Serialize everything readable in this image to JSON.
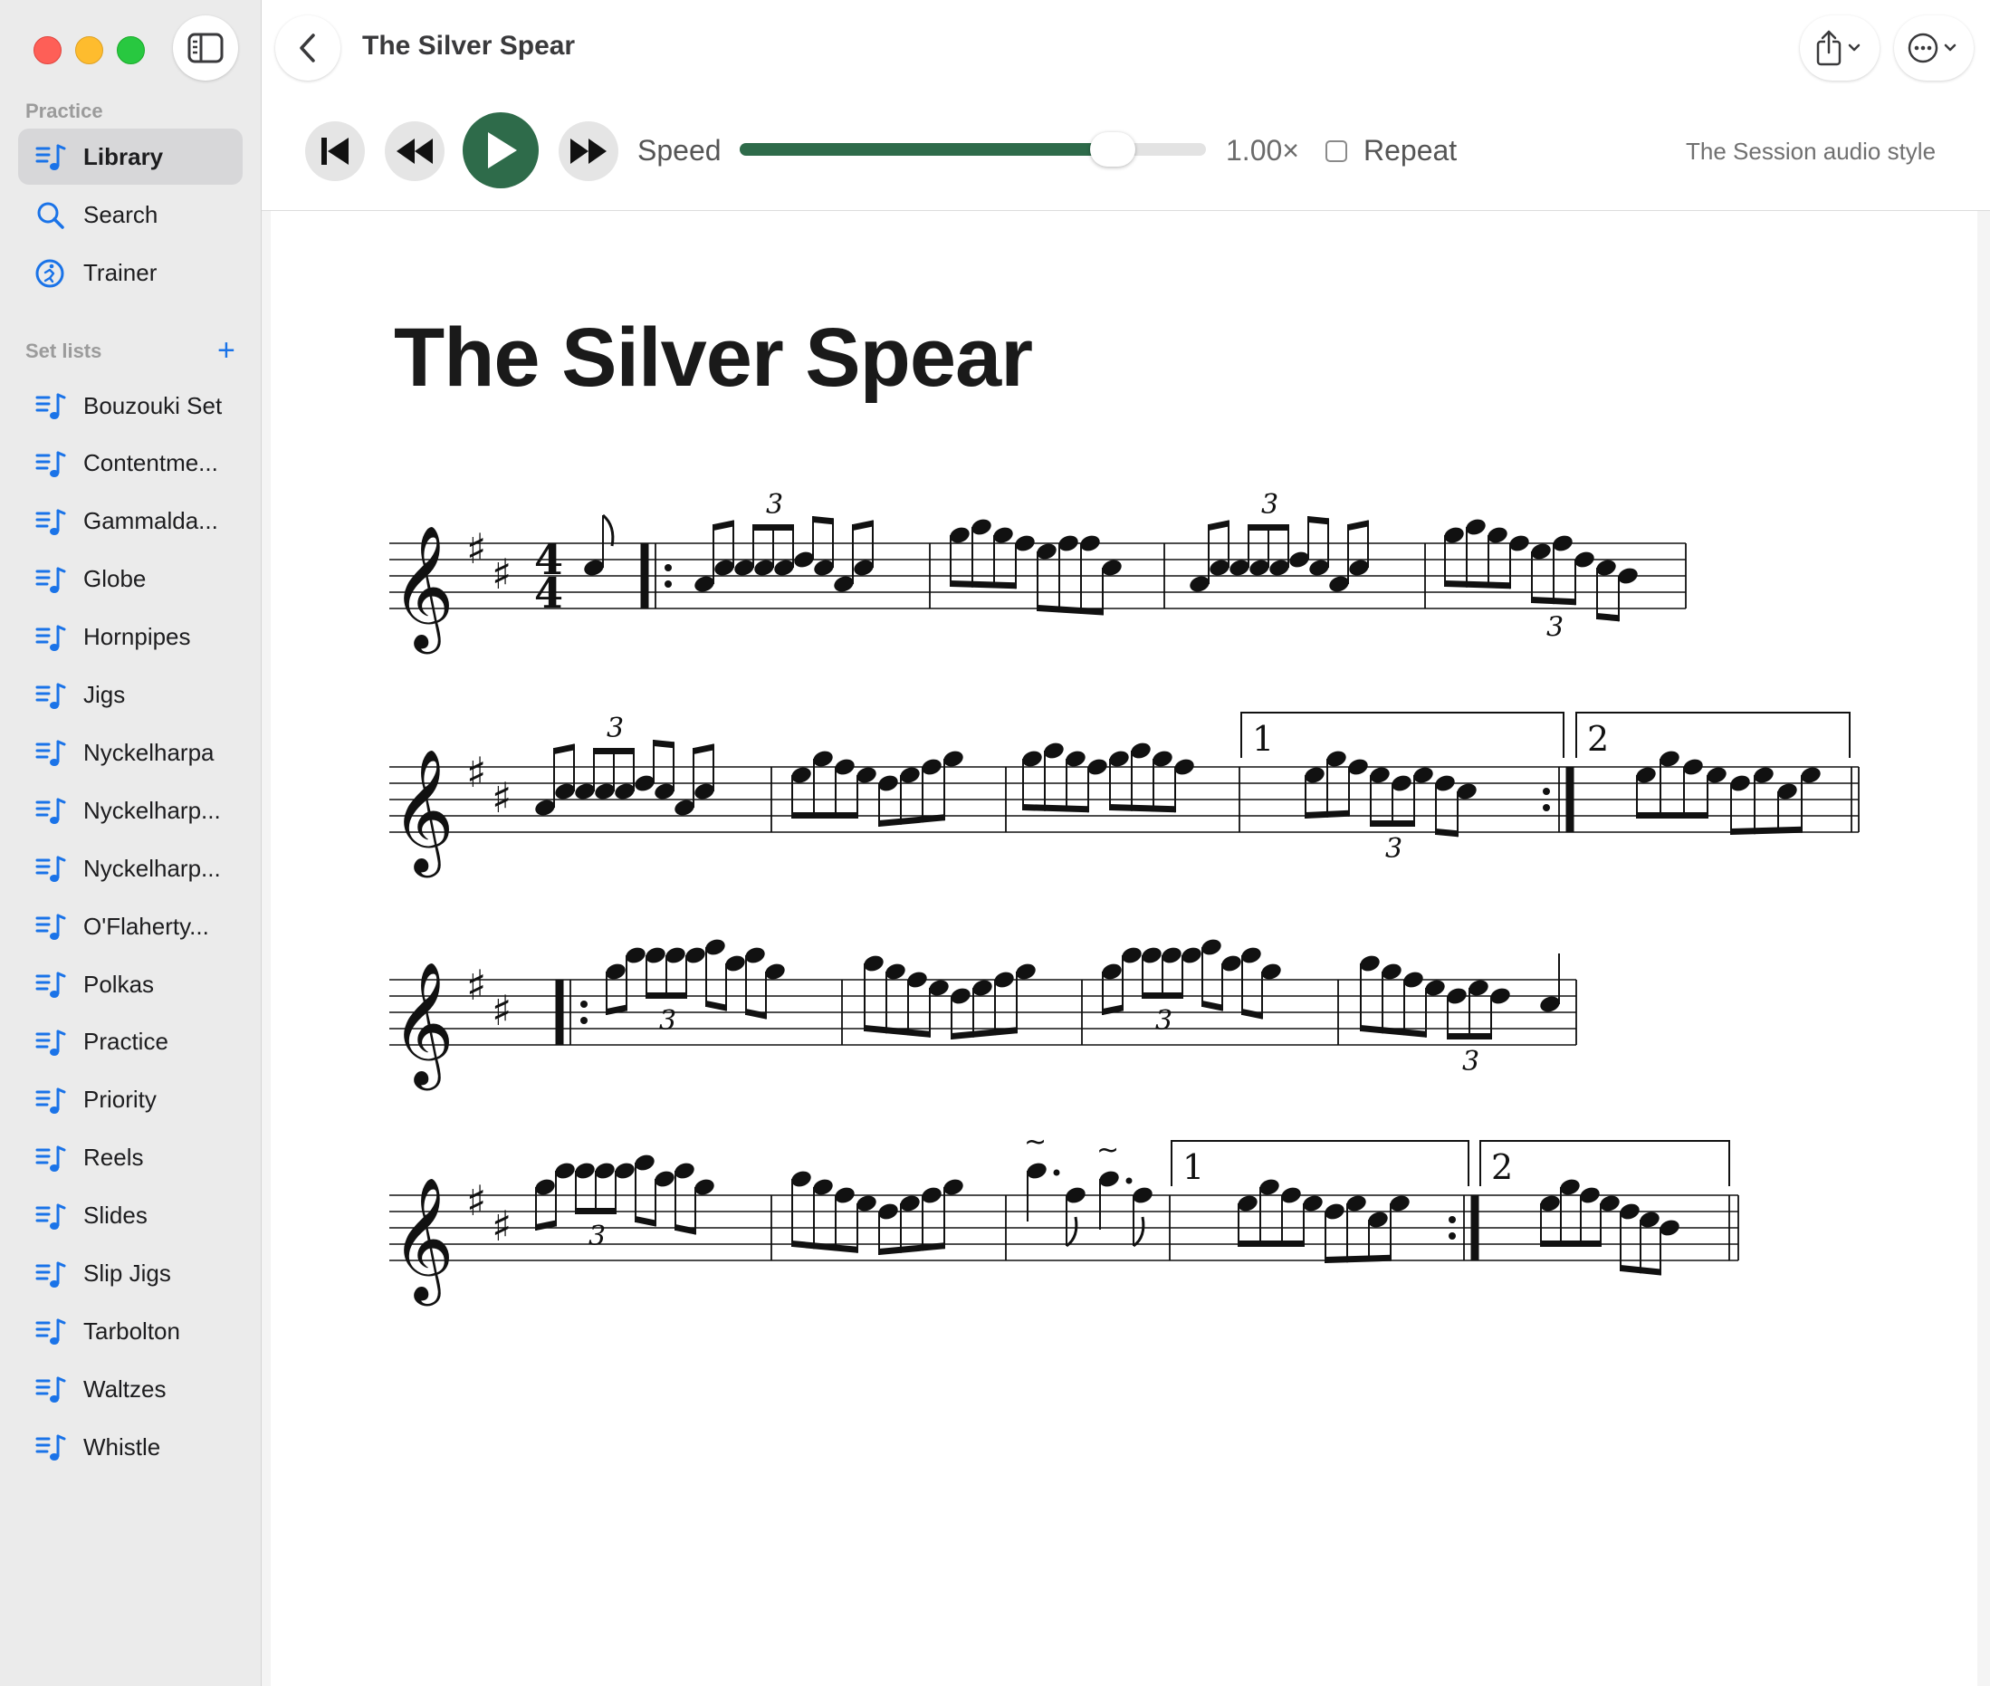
{
  "window": {
    "title": "The Silver Spear"
  },
  "sidebar": {
    "practice_label": "Practice",
    "practice_items": [
      {
        "label": "Library",
        "icon": "music-list-icon",
        "selected": true
      },
      {
        "label": "Search",
        "icon": "search-icon",
        "selected": false
      },
      {
        "label": "Trainer",
        "icon": "trainer-icon",
        "selected": false
      }
    ],
    "setlists_label": "Set lists",
    "add_label": "+",
    "setlists": [
      {
        "label": "Bouzouki Set"
      },
      {
        "label": "Contentme..."
      },
      {
        "label": "Gammalda..."
      },
      {
        "label": "Globe"
      },
      {
        "label": "Hornpipes"
      },
      {
        "label": "Jigs"
      },
      {
        "label": "Nyckelharpa"
      },
      {
        "label": "Nyckelharp..."
      },
      {
        "label": "Nyckelharp..."
      },
      {
        "label": "O'Flaherty..."
      },
      {
        "label": "Polkas"
      },
      {
        "label": "Practice"
      },
      {
        "label": "Priority"
      },
      {
        "label": "Reels"
      },
      {
        "label": "Slides"
      },
      {
        "label": "Slip Jigs"
      },
      {
        "label": "Tarbolton"
      },
      {
        "label": "Waltzes"
      },
      {
        "label": "Whistle"
      }
    ]
  },
  "player": {
    "speed_label": "Speed",
    "speed_value": "1.00×",
    "speed_fraction": 0.8,
    "repeat_label": "Repeat",
    "repeat_checked": false,
    "audio_style": "The Session audio style"
  },
  "score": {
    "title": "The Silver Spear",
    "time_signature": {
      "top": "4",
      "bottom": "4"
    },
    "key_sharps": 2,
    "tuplet_label": "3",
    "ending_labels": [
      "1",
      "2"
    ],
    "ornament": "~"
  },
  "colors": {
    "accent_green": "#2e6b4a",
    "sidebar_blue": "#1a73e8",
    "sidebar_bg": "#ebebeb",
    "selected_bg": "#d7d7d9"
  }
}
